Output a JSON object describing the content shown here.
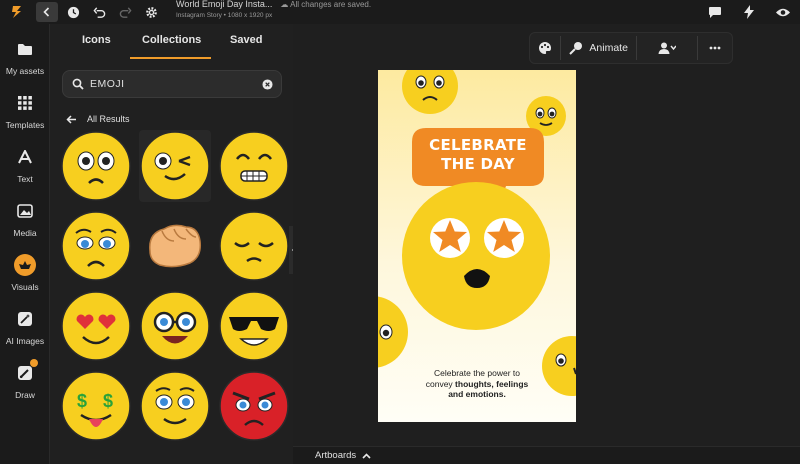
{
  "topbar": {
    "doc_title": "World Emoji Day Insta...",
    "saved_status": "All changes are saved.",
    "doc_subtitle": "Instagram Story • 1080 x 1920 px"
  },
  "sidebar": {
    "items": [
      {
        "label": "My assets",
        "icon": "folder-icon"
      },
      {
        "label": "Templates",
        "icon": "grid-icon"
      },
      {
        "label": "Text",
        "icon": "text-icon"
      },
      {
        "label": "Media",
        "icon": "image-icon"
      },
      {
        "label": "Visuals",
        "icon": "visuals-icon"
      },
      {
        "label": "AI Images",
        "icon": "magic-wand-icon"
      },
      {
        "label": "Draw",
        "icon": "brush-icon"
      }
    ]
  },
  "panel": {
    "tabs": [
      "Icons",
      "Collections",
      "Saved"
    ],
    "active_tab": "Collections",
    "search_value": "EMOJI",
    "back_label": "All Results",
    "results": [
      "frowning-face",
      "winking-face",
      "grimacing-face",
      "worried-face",
      "fist",
      "pensive-face",
      "heart-eyes-face",
      "nerd-face",
      "sunglasses-face",
      "money-mouth-face",
      "smiling-face",
      "angry-face"
    ]
  },
  "toolbar": {
    "animate_label": "Animate"
  },
  "poster": {
    "bubble_line1": "CELEBRATE",
    "bubble_line2": "THE DAY",
    "body_line1": "Celebrate the power to",
    "body_line2_plain": "convey ",
    "body_line2_bold": "thoughts, feelings",
    "body_line3_bold": "and emotions."
  },
  "bottombar": {
    "artboards_label": "Artboards"
  },
  "colors": {
    "accent": "#f09c2a",
    "emoji_yellow": "#f7cf1f",
    "bubble_orange": "#f08a24"
  }
}
